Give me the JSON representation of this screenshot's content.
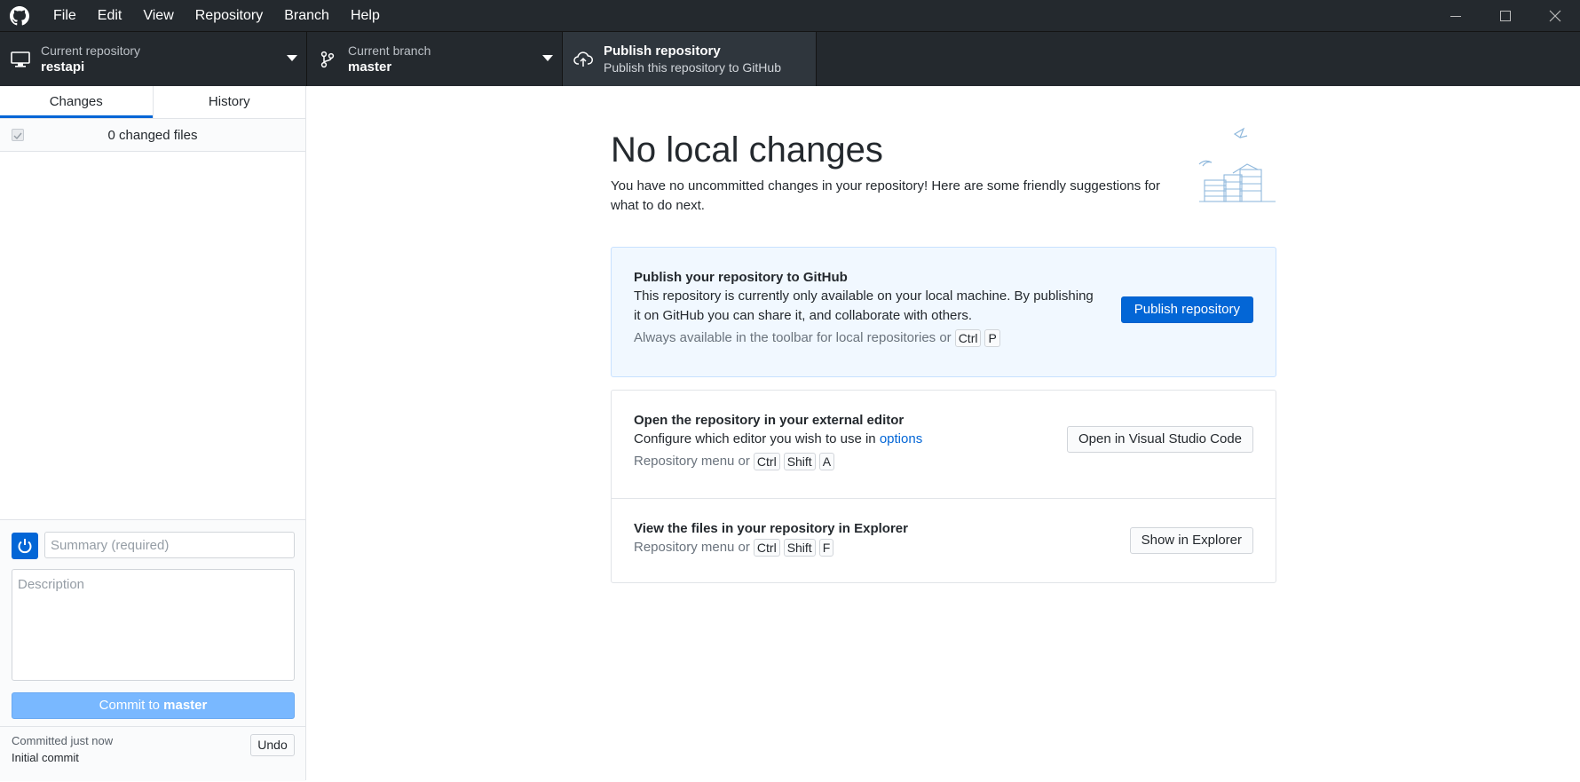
{
  "menu": {
    "items": [
      {
        "label": "File"
      },
      {
        "label": "Edit"
      },
      {
        "label": "View"
      },
      {
        "label": "Repository"
      },
      {
        "label": "Branch"
      },
      {
        "label": "Help"
      }
    ]
  },
  "toolbar": {
    "repository": {
      "description": "Current repository",
      "value": "restapi",
      "icon": "desktop-icon"
    },
    "branch": {
      "description": "Current branch",
      "value": "master",
      "icon": "git-branch-icon"
    },
    "publish": {
      "title": "Publish repository",
      "description": "Publish this repository to GitHub",
      "icon": "cloud-upload-icon"
    }
  },
  "sidebar": {
    "tabs": [
      {
        "label": "Changes",
        "selected": true
      },
      {
        "label": "History",
        "selected": false
      }
    ],
    "changes_count": "0 changed files",
    "commit": {
      "summary_placeholder": "Summary (required)",
      "description_placeholder": "Description",
      "button_prefix": "Commit to",
      "button_branch": "master"
    },
    "undo": {
      "time": "Committed just now",
      "message": "Initial commit",
      "button": "Undo"
    }
  },
  "main": {
    "title": "No local changes",
    "subtitle": "You have no uncommitted changes in your repository! Here are some friendly suggestions for what to do next.",
    "publish_card": {
      "title": "Publish your repository to GitHub",
      "body": "This repository is currently only available on your local machine. By publishing it on GitHub you can share it, and collaborate with others.",
      "hint": "Always available in the toolbar for local repositories or",
      "keys": [
        "Ctrl",
        "P"
      ],
      "button": "Publish repository"
    },
    "editor_card": {
      "title": "Open the repository in your external editor",
      "body_prefix": "Configure which editor you wish to use in",
      "body_link": "options",
      "hint": "Repository menu or",
      "keys": [
        "Ctrl",
        "Shift",
        "A"
      ],
      "button": "Open in Visual Studio Code"
    },
    "explorer_card": {
      "title": "View the files in your repository in Explorer",
      "hint": "Repository menu or",
      "keys": [
        "Ctrl",
        "Shift",
        "F"
      ],
      "button": "Show in Explorer"
    }
  },
  "colors": {
    "titlebar": "#24292e",
    "accent": "#0366d6",
    "commit_button": "#79b8ff",
    "publish_card_bg": "#f1f8ff"
  }
}
